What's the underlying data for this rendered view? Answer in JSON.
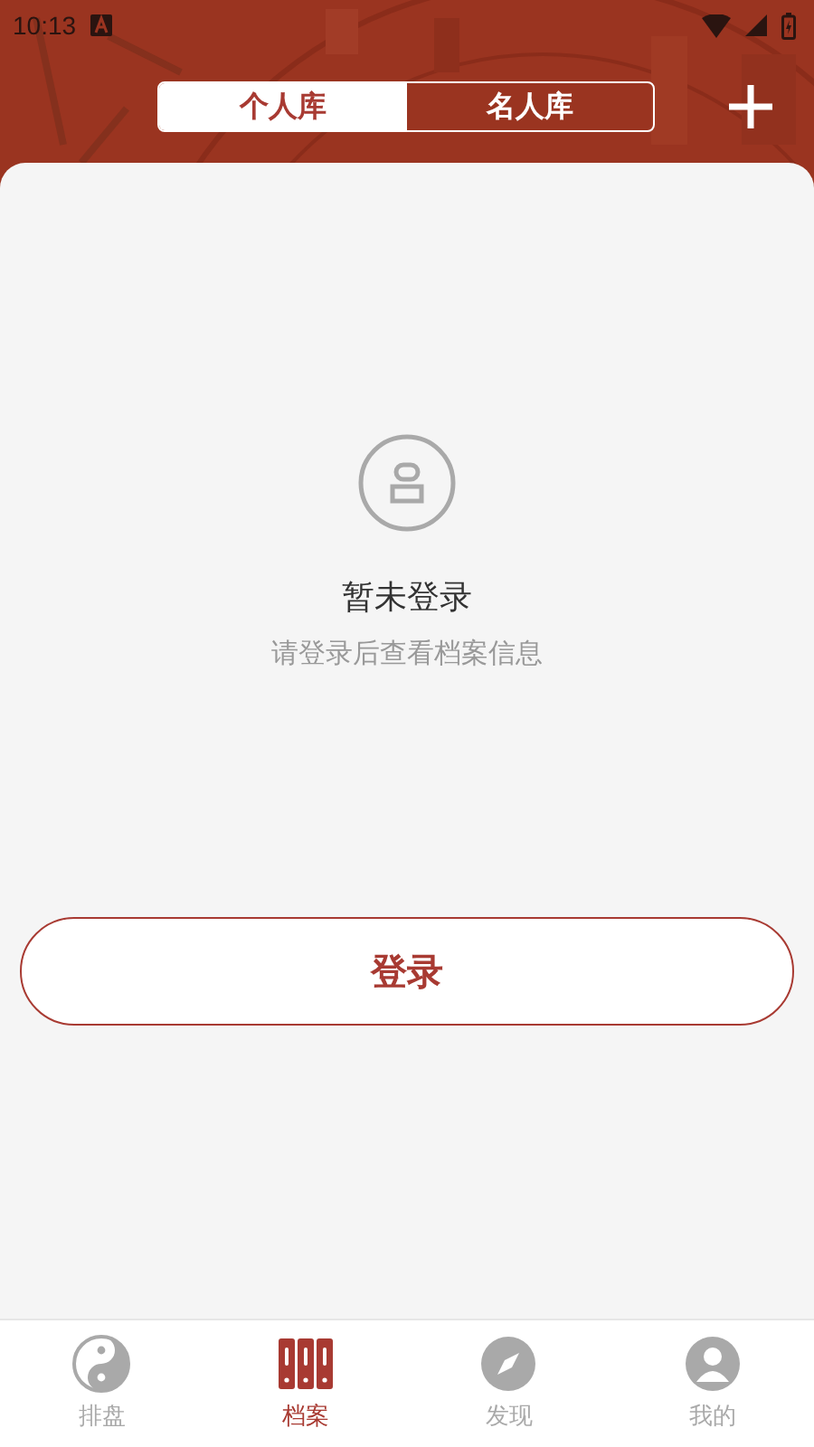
{
  "status_bar": {
    "time": "10:13"
  },
  "segments": [
    {
      "label": "个人库",
      "selected": true
    },
    {
      "label": "名人库",
      "selected": false
    }
  ],
  "empty_state": {
    "title": "暂未登录",
    "message": "请登录后查看档案信息"
  },
  "login_button": "登录",
  "bottom_nav": [
    {
      "label": "排盘",
      "kind": "yinyang",
      "selected": false
    },
    {
      "label": "档案",
      "kind": "archive",
      "selected": true
    },
    {
      "label": "发现",
      "kind": "discover",
      "selected": false
    },
    {
      "label": "我的",
      "kind": "profile",
      "selected": false
    }
  ]
}
